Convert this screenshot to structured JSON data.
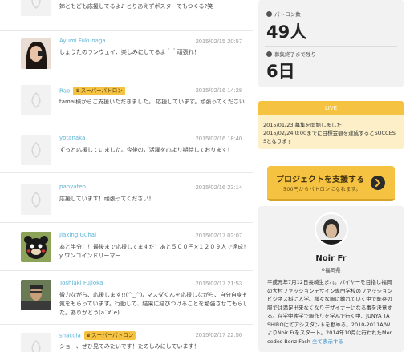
{
  "comments": [
    {
      "name": "",
      "date": "",
      "lines": [
        "姉ともども応援してるよ♪ とりあえずポスターでもつくる?笑"
      ],
      "badge": ""
    },
    {
      "name": "Ayumi Fukunaga",
      "date": "2015/02/15 20:57",
      "lines": [
        "しょうたのランウェイ、楽しみにしてるよ＾＾頑張れ！"
      ],
      "badge": ""
    },
    {
      "name": "Rao",
      "date": "2015/02/16 14:28",
      "lines": [
        "tamai様からご支援いただきました。 応援しています。頑張ってください！"
      ],
      "badge": "スーパーパトロン"
    },
    {
      "name": "yotanaka",
      "date": "2015/02/16 18:40",
      "lines": [
        "ずっと応援していました。今後のご活躍を心より期待しております！"
      ],
      "badge": ""
    },
    {
      "name": "panyaten",
      "date": "2015/02/16 23:14",
      "lines": [
        "応援しています！頑張ってください！"
      ],
      "badge": ""
    },
    {
      "name": "Jiaxing Guhai",
      "date": "2015/02/17 02:07",
      "lines": [
        "あと半分！！最後まで応援してますだ！あと５００円×１２０９人で達成！　b",
        "y ワンコインドリーマー"
      ],
      "badge": ""
    },
    {
      "name": "Toshiaki Fujioka",
      "date": "2015/02/17 21:53",
      "lines": [
        "微力ながら、応援します!!(^_^)ﾉ マスダくんを応援しながら、自分自身も勇",
        "気をもらっています。行動して、結果に結びつけることを勉強させてもらいまし",
        "た。ありがとう(a´∀`e)"
      ],
      "badge": ""
    },
    {
      "name": "shacoia",
      "date": "2015/02/17 22:50",
      "lines": [
        "ショー、ぜひ見てみたいです！たのしみにしています！"
      ],
      "badge": "スーパーパトロン"
    }
  ],
  "sidebar": {
    "patrons_label": "パトロン数",
    "patrons_value": "49人",
    "remaining_label": "募集終了まで残り",
    "remaining_value": "6日",
    "live_label": "LIVE",
    "live_lines": [
      "2015/01/23 募集を開始しました",
      "2015/02/24 0:00までに目標金額を達成するとSUCCES",
      "Sとなります"
    ],
    "support_label": "プロジェクトを支援する",
    "support_sub": "500円からパトロンになれます。",
    "profile_name": "Noir Fr",
    "profile_location": "福岡県",
    "profile_bio": [
      "平成元年7月12日長崎生まれ。バイヤーを目指し福岡",
      "の大村ファッションデザイン専門学校のファッション",
      "ビジネス科に入学。様々な服に触れていく中で既存の",
      "服では満足出来なくなりデザイナーになる事を決意す",
      "る。在学中独学で服作りを学んで行く中、JUNYA TA",
      "SHIROにてアシスタントを勤める。2010-2011A/W",
      "よりNoir Frをスタート。2014年10月に行われたMer",
      "cedes-Benz Fash"
    ],
    "more_link": "全て表示する"
  },
  "colors": {
    "accent": "#f5c242",
    "link": "#5ab4d6",
    "panel": "#f2f2f2"
  }
}
